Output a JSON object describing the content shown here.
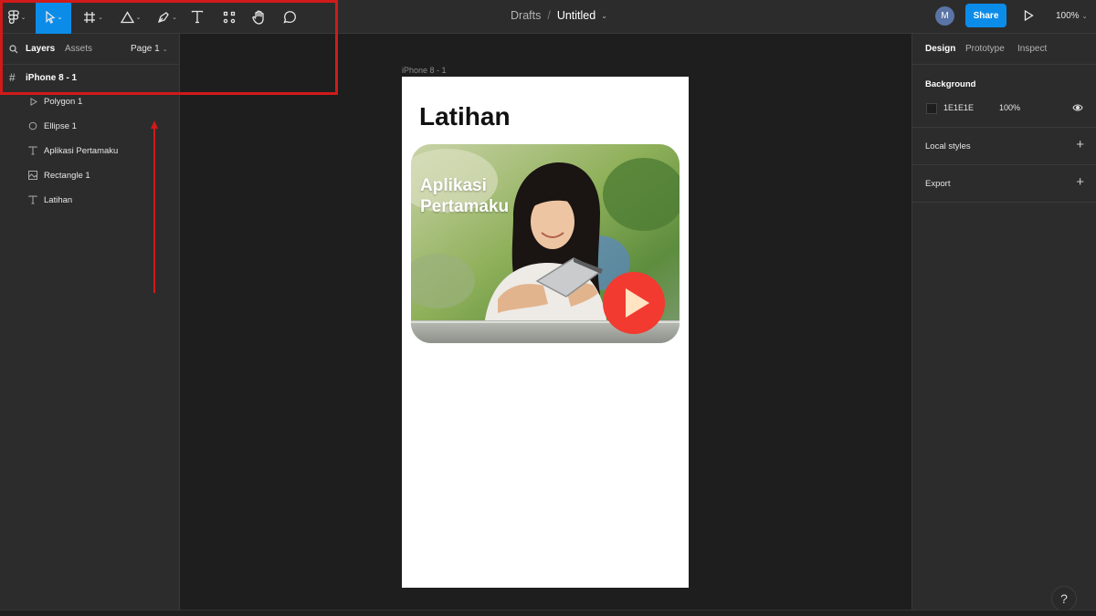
{
  "toolbar": {
    "tools": [
      "main-menu",
      "move",
      "frame",
      "shape",
      "pen",
      "text",
      "resources",
      "hand",
      "comment"
    ],
    "breadcrumb": {
      "drafts": "Drafts",
      "separator": "/",
      "file": "Untitled"
    },
    "avatar_initial": "M",
    "share_label": "Share",
    "zoom": "100%"
  },
  "left_panel": {
    "tabs": {
      "layers": "Layers",
      "assets": "Assets",
      "page": "Page 1"
    },
    "frame": "iPhone 8 - 1",
    "layers": [
      {
        "label": "Polygon 1",
        "icon": "polygon-icon"
      },
      {
        "label": "Ellipse 1",
        "icon": "ellipse-icon"
      },
      {
        "label": "Aplikasi Pertamaku",
        "icon": "text-icon"
      },
      {
        "label": "Rectangle 1",
        "icon": "image-icon"
      },
      {
        "label": "Latihan",
        "icon": "text-icon"
      }
    ]
  },
  "canvas": {
    "frame_label": "iPhone 8 - 1",
    "title": "Latihan",
    "card_text": "Aplikasi Pertamaku",
    "play_color": "#f23a30"
  },
  "right_panel": {
    "tabs": {
      "design": "Design",
      "prototype": "Prototype",
      "inspect": "Inspect"
    },
    "background": {
      "heading": "Background",
      "hex": "1E1E1E",
      "opacity": "100%"
    },
    "local_styles": "Local styles",
    "export": "Export"
  },
  "colors": {
    "accent": "#0c8ce9",
    "annotation": "#d11a1a",
    "panel": "#2c2c2c",
    "canvas": "#1e1e1e"
  }
}
